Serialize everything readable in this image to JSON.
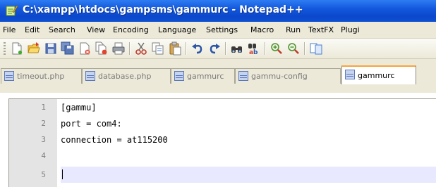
{
  "window": {
    "title": "C:\\xampp\\htdocs\\gampsms\\gammurc - Notepad++",
    "app_icon": "notepad-plus-plus-icon"
  },
  "menu": [
    {
      "label": "File"
    },
    {
      "label": "Edit"
    },
    {
      "label": "Search"
    },
    {
      "label": "View"
    },
    {
      "label": "Encoding"
    },
    {
      "label": "Language"
    },
    {
      "label": "Settings"
    },
    {
      "label": "Macro"
    },
    {
      "label": "Run"
    },
    {
      "label": "TextFX"
    },
    {
      "label": "Plugi"
    }
  ],
  "toolbar": {
    "buttons": [
      "new-file-icon",
      "open-file-icon",
      "save-icon",
      "save-all-icon",
      "close-icon",
      "close-all-icon",
      "print-icon",
      "cut-icon",
      "copy-icon",
      "paste-icon",
      "undo-icon",
      "redo-icon",
      "find-icon",
      "replace-icon",
      "zoom-in-icon",
      "zoom-out-icon",
      "sync-scroll-icon"
    ]
  },
  "tabs": [
    {
      "label": "timeout.php",
      "active": false
    },
    {
      "label": "database.php",
      "active": false
    },
    {
      "label": "gammurc",
      "active": false
    },
    {
      "label": "gammu-config",
      "active": false
    },
    {
      "label": "gammurc",
      "active": true
    }
  ],
  "editor": {
    "lines": [
      {
        "num": "1",
        "text": "[gammu]"
      },
      {
        "num": "2",
        "text": "port = com4:"
      },
      {
        "num": "3",
        "text": "connection = at115200"
      },
      {
        "num": "4",
        "text": ""
      },
      {
        "num": "5",
        "text": ""
      }
    ],
    "current_line": 5
  },
  "colors": {
    "titlebar": "#0b48cc",
    "active_tab_accent": "#f6a53b",
    "current_line_highlight": "#e8e8ff",
    "gutter": "#e4e4e4"
  }
}
